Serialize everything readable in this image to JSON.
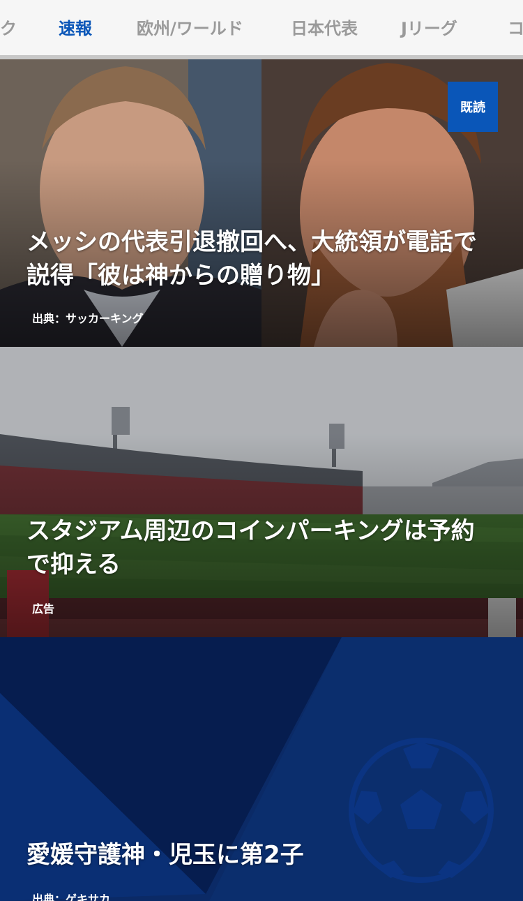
{
  "tabs": [
    {
      "label": "ク",
      "active": false
    },
    {
      "label": "速報",
      "active": true
    },
    {
      "label": "欧州/ワールド",
      "active": false
    },
    {
      "label": "日本代表",
      "active": false
    },
    {
      "label": "Jリーグ",
      "active": false
    },
    {
      "label": "コ",
      "active": false
    }
  ],
  "colors": {
    "accent": "#0a56b8",
    "tab_inactive": "#9a9a9a",
    "placeholder_navy": "#0b2a66"
  },
  "articles": [
    {
      "title": "メッシの代表引退撤回へ、大統領が電話で説得「彼は神からの贈り物」",
      "source": "出典：サッカーキング",
      "badge": "既読"
    },
    {
      "title": "スタジアム周辺のコインパーキングは予約で抑える",
      "source": "広告"
    },
    {
      "title": "愛媛守護神・児玉に第2子",
      "source": "出典：ゲキサカ",
      "icon": "soccer-ball-icon"
    }
  ]
}
